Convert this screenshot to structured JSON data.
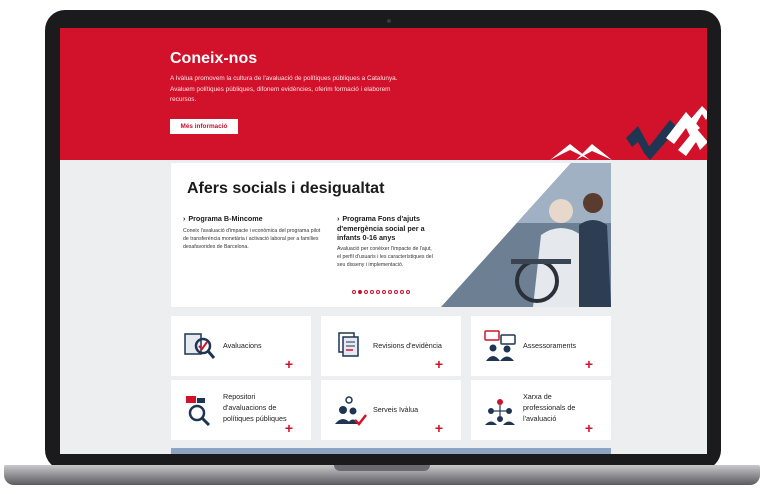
{
  "colors": {
    "brand_red": "#d2122a",
    "navy": "#1f3552",
    "screen_bg": "#eceeef"
  },
  "hero": {
    "title": "Coneix-nos",
    "text": "A Ivàlua promovem la cultura de l'avaluació de polítiques públiques a Catalunya. Avaluem polítiques públiques, difonem evidències, oferim formació i elaborem recursos.",
    "button_label": "Més informació"
  },
  "feature": {
    "title": "Afers socials i desigualtat",
    "items": [
      {
        "title": "Programa B-Mincome",
        "text": "Coneix l'avaluació d'impacte i econòmica del programa pilot de transferència monetària i activació laboral per a famílies desafavorides de Barcelona."
      },
      {
        "title": "Programa Fons d'ajuts d'emergència social per a infants 0-16 anys",
        "text": "Avaluació per conèixer l'impacte de l'ajut, el perfil d'usuaris i les característiques del seu disseny i implementació."
      }
    ],
    "carousel": {
      "count": 10,
      "active": 2
    }
  },
  "cards": [
    {
      "label": "Avaluacions",
      "icon": "magnifier-document-icon"
    },
    {
      "label": "Revisions d'evidència",
      "icon": "documents-stack-icon"
    },
    {
      "label": "Assessoraments",
      "icon": "people-chat-icon"
    },
    {
      "label": "Repositori d'avaluacions de polítiques públiques",
      "icon": "search-repository-icon"
    },
    {
      "label": "Serveis Ivàlua",
      "icon": "people-gear-check-icon"
    },
    {
      "label": "Xarxa de professionals de l'avaluació",
      "icon": "network-people-icon"
    }
  ],
  "plus_symbol": "+"
}
